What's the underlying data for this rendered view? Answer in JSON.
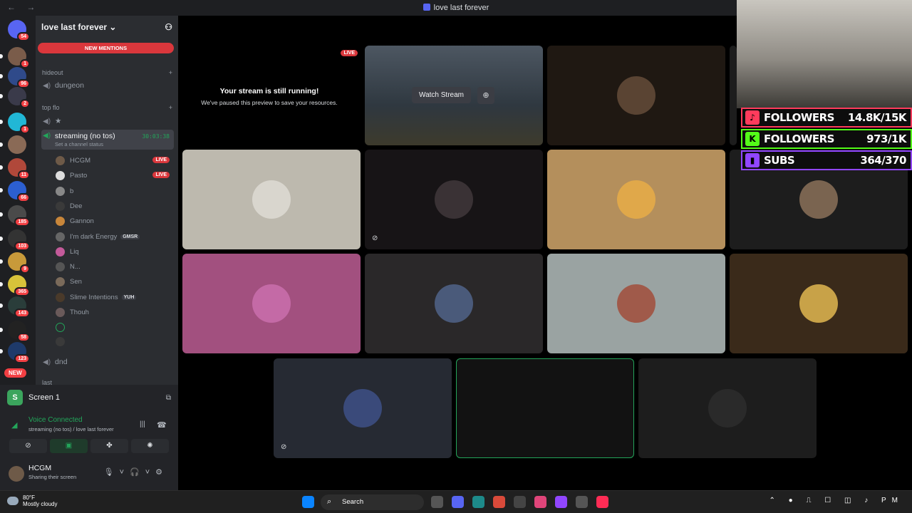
{
  "window": {
    "title": "love last forever"
  },
  "server": {
    "name": "love last forever",
    "new_mentions": "NEW MENTIONS",
    "new_pill": "NEW",
    "icons": [
      {
        "badge": "54",
        "color": "#5865f2"
      },
      {
        "badge": "1",
        "color": "#7a5c4a"
      },
      {
        "badge": "96",
        "color": "#2f4a8a"
      },
      {
        "badge": "2",
        "color": "#3a3a4a"
      },
      {
        "badge": "1",
        "color": "#21b7d6"
      },
      {
        "badge": "",
        "color": "#8a6a56"
      },
      {
        "badge": "11",
        "color": "#b0483a"
      },
      {
        "badge": "66",
        "color": "#2c5fd0"
      },
      {
        "badge": "185",
        "color": "#4a4a4a"
      },
      {
        "badge": "103",
        "color": "#333"
      },
      {
        "badge": "9",
        "color": "#c89a3a"
      },
      {
        "badge": "365",
        "color": "#d8c23a"
      },
      {
        "badge": "143",
        "color": "#2a3d3a"
      },
      {
        "badge": "58",
        "color": "#222"
      },
      {
        "badge": "123",
        "color": "#1e3a6a"
      }
    ]
  },
  "categories": {
    "hideout": "hideout",
    "top_flo": "top flo",
    "last": "last"
  },
  "channels": {
    "dungeon": "dungeon",
    "star": "★",
    "active_name": "streaming (no tos)",
    "active_timer": "30:03:38",
    "active_status": "Set a channel status",
    "dnd": "dnd"
  },
  "members": [
    {
      "name": "HCGM",
      "live": "LIVE",
      "color": "#6e5a48"
    },
    {
      "name": "Pasto",
      "live": "LIVE",
      "color": "#ddd"
    },
    {
      "name": "b",
      "live": "",
      "color": "#888"
    },
    {
      "name": "Dee",
      "live": "",
      "color": "#3a3a3a"
    },
    {
      "name": "Gannon",
      "live": "",
      "color": "#c8863a"
    },
    {
      "name": "I'm dark Energy",
      "live": "",
      "color": "#666",
      "tag": "GMSR"
    },
    {
      "name": "Liq",
      "live": "",
      "color": "#c35a9a"
    },
    {
      "name": "N...",
      "live": "",
      "color": "#555"
    },
    {
      "name": "Sen",
      "live": "",
      "color": "#7a6a5a"
    },
    {
      "name": "Slime Intentions",
      "live": "",
      "color": "#4a3a2a",
      "tag": "YUH"
    },
    {
      "name": "Thouh",
      "live": "",
      "color": "#6a5a5a"
    }
  ],
  "panel": {
    "screen_label": "Screen 1",
    "voice_connected": "Voice Connected",
    "voice_sub": "streaming (no tos) / love last forever",
    "username": "HCGM",
    "user_status": "Sharing their screen"
  },
  "stream": {
    "live": "LIVE",
    "heading": "Your stream is still running!",
    "sub": "We've paused this preview to save your resources.",
    "watch": "Watch Stream"
  },
  "overlay": [
    {
      "label": "FOLLOWERS",
      "value": "14.8K/15K",
      "color": "#ff3b5c",
      "icon": "tiktok-icon",
      "glyph": "♪"
    },
    {
      "label": "FOLLOWERS",
      "value": "973/1K",
      "color": "#53fc18",
      "icon": "kick-icon",
      "glyph": "K"
    },
    {
      "label": "SUBS",
      "value": "364/370",
      "color": "#9146ff",
      "icon": "twitch-icon",
      "glyph": "▮"
    }
  ],
  "taskbar": {
    "temp": "80°F",
    "weather": "Mostly cloudy",
    "search": "Search",
    "time": "PM"
  }
}
